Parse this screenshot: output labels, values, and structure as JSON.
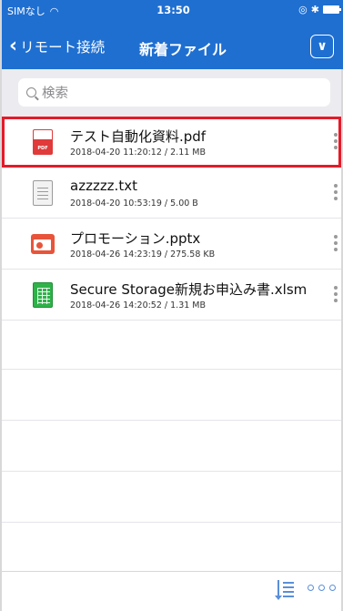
{
  "status_bar": {
    "carrier": "SIMなし",
    "time": "13:50"
  },
  "nav": {
    "back_label": "リモート接続",
    "title": "新着ファイル"
  },
  "search": {
    "placeholder": "検索"
  },
  "files": [
    {
      "name": "テスト自動化資料.pdf",
      "meta": "2018-04-20 11:20:12 / 2.11 MB",
      "type_icon": "pdf-file-icon",
      "highlighted": true
    },
    {
      "name": "azzzzz.txt",
      "meta": "2018-04-20 10:53:19 / 5.00 B",
      "type_icon": "text-file-icon",
      "highlighted": false
    },
    {
      "name": "プロモーション.pptx",
      "meta": "2018-04-26 14:23:19 / 275.58 KB",
      "type_icon": "powerpoint-file-icon",
      "highlighted": false
    },
    {
      "name": "Secure Storage新規お申込み書.xlsm",
      "meta": "2018-04-26 14:20:52 / 1.31 MB",
      "type_icon": "excel-file-icon",
      "highlighted": false
    }
  ],
  "pdf_badge": "PDF",
  "colors": {
    "header": "#1f6fd1",
    "highlight": "#e31b2a",
    "toolbar_icon": "#5a8fd8"
  }
}
